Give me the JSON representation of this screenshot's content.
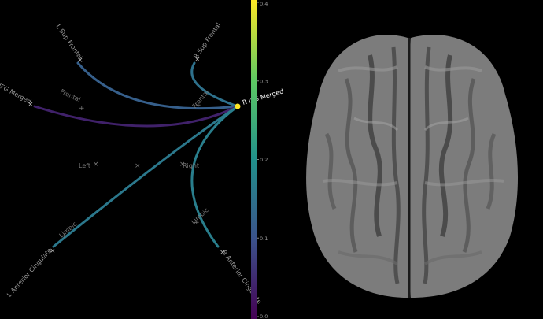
{
  "connectogram": {
    "seed_label": "R IFG Merged",
    "nodes": [
      {
        "label": "L Sup Frontal"
      },
      {
        "label": "R Sup Frontal"
      },
      {
        "label": "L IFG Merged"
      },
      {
        "label": "L Anterior Cingulate"
      },
      {
        "label": "R Anterior Cingulate"
      }
    ],
    "region_labels": [
      {
        "label": "Frontal",
        "marker": "+"
      },
      {
        "label": "Frontal",
        "marker": "+"
      },
      {
        "label": "Left",
        "marker": "×"
      },
      {
        "label": "Right",
        "marker": "×"
      },
      {
        "label": "Limbic",
        "marker": "+"
      },
      {
        "label": "Limbic",
        "marker": "+"
      }
    ],
    "connections": [
      {
        "target": "L Sup Frontal",
        "strength": 0.12
      },
      {
        "target": "R Sup Frontal",
        "strength": 0.15
      },
      {
        "target": "L IFG Merged",
        "strength": 0.04
      },
      {
        "target": "L Anterior Cingulate",
        "strength": 0.16
      },
      {
        "target": "R Anterior Cingulate",
        "strength": 0.17
      }
    ]
  },
  "colorbar": {
    "ticks": [
      "0.0",
      "0.1",
      "0.2",
      "0.3",
      "0.4"
    ],
    "min": 0.0,
    "max": 0.4,
    "colormap": [
      "#440154",
      "#3b528b",
      "#21918c",
      "#5ec962",
      "#fde725"
    ]
  },
  "brain_view": {
    "name": "brain-top-view",
    "fill": "#8a8a8a"
  }
}
